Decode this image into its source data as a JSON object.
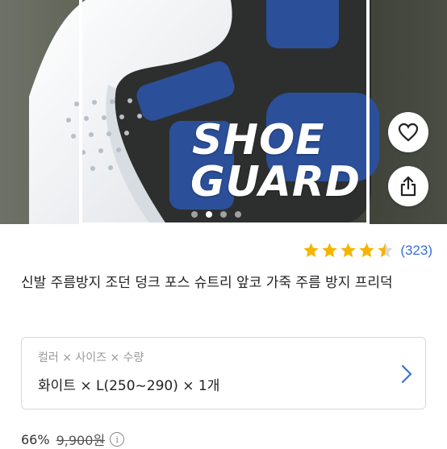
{
  "hero": {
    "logo_line1": "SHOE",
    "logo_line2": "GUARD",
    "like_icon": "heart-icon",
    "share_icon": "share-icon",
    "carousel_pages": 4,
    "carousel_active": 1
  },
  "rating": {
    "stars": 4.5,
    "count": "(323)",
    "color": "#f5b400"
  },
  "product": {
    "title": "신발 주름방지 조던 덩크 포스 슈트리 앞코 가죽 주름 방지 프리덕"
  },
  "option": {
    "label": "컬러 × 사이즈 × 수량",
    "value": "화이트 × L(250~290) × 1개",
    "chevron_icon": "chevron-right-icon",
    "accent": "#3b6fd6"
  },
  "price": {
    "discount": "66%",
    "original": "9,900원",
    "info_icon": "info-icon"
  }
}
